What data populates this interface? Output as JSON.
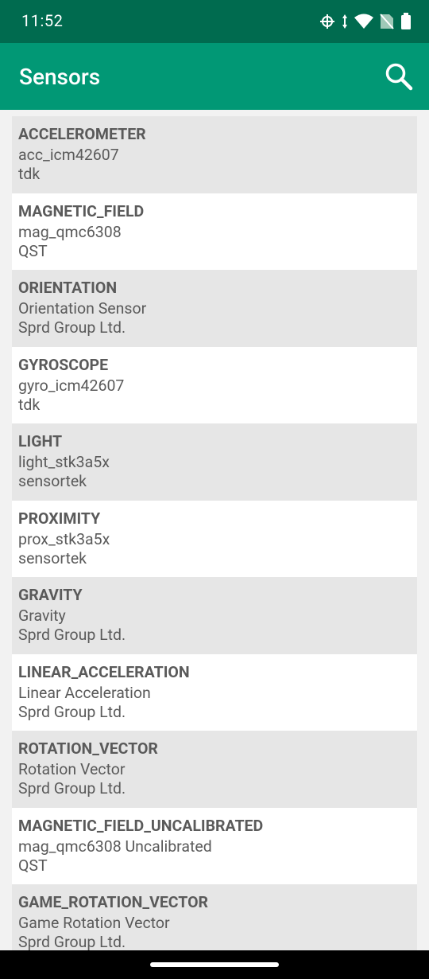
{
  "status_bar": {
    "time": "11:52",
    "icons": [
      "cast-icon",
      "data-arrows-icon",
      "wifi-icon",
      "no-sim-icon",
      "battery-icon"
    ]
  },
  "app_bar": {
    "title": "Sensors",
    "search_icon": "search-icon",
    "color": "#019875",
    "status_color": "#006b4f"
  },
  "sensors": [
    {
      "type": "ACCELEROMETER",
      "name": "acc_icm42607",
      "vendor": "tdk"
    },
    {
      "type": "MAGNETIC_FIELD",
      "name": "mag_qmc6308",
      "vendor": "QST"
    },
    {
      "type": "ORIENTATION",
      "name": "Orientation Sensor",
      "vendor": "Sprd Group Ltd."
    },
    {
      "type": "GYROSCOPE",
      "name": "gyro_icm42607",
      "vendor": "tdk"
    },
    {
      "type": "LIGHT",
      "name": "light_stk3a5x",
      "vendor": "sensortek"
    },
    {
      "type": "PROXIMITY",
      "name": "prox_stk3a5x",
      "vendor": "sensortek"
    },
    {
      "type": "GRAVITY",
      "name": "Gravity",
      "vendor": "Sprd Group Ltd."
    },
    {
      "type": "LINEAR_ACCELERATION",
      "name": "Linear Acceleration",
      "vendor": "Sprd Group Ltd."
    },
    {
      "type": "ROTATION_VECTOR",
      "name": "Rotation Vector",
      "vendor": "Sprd Group Ltd."
    },
    {
      "type": "MAGNETIC_FIELD_UNCALIBRATED",
      "name": "mag_qmc6308 Uncalibrated",
      "vendor": "QST"
    },
    {
      "type": "GAME_ROTATION_VECTOR",
      "name": "Game Rotation Vector",
      "vendor": "Sprd Group Ltd."
    }
  ]
}
